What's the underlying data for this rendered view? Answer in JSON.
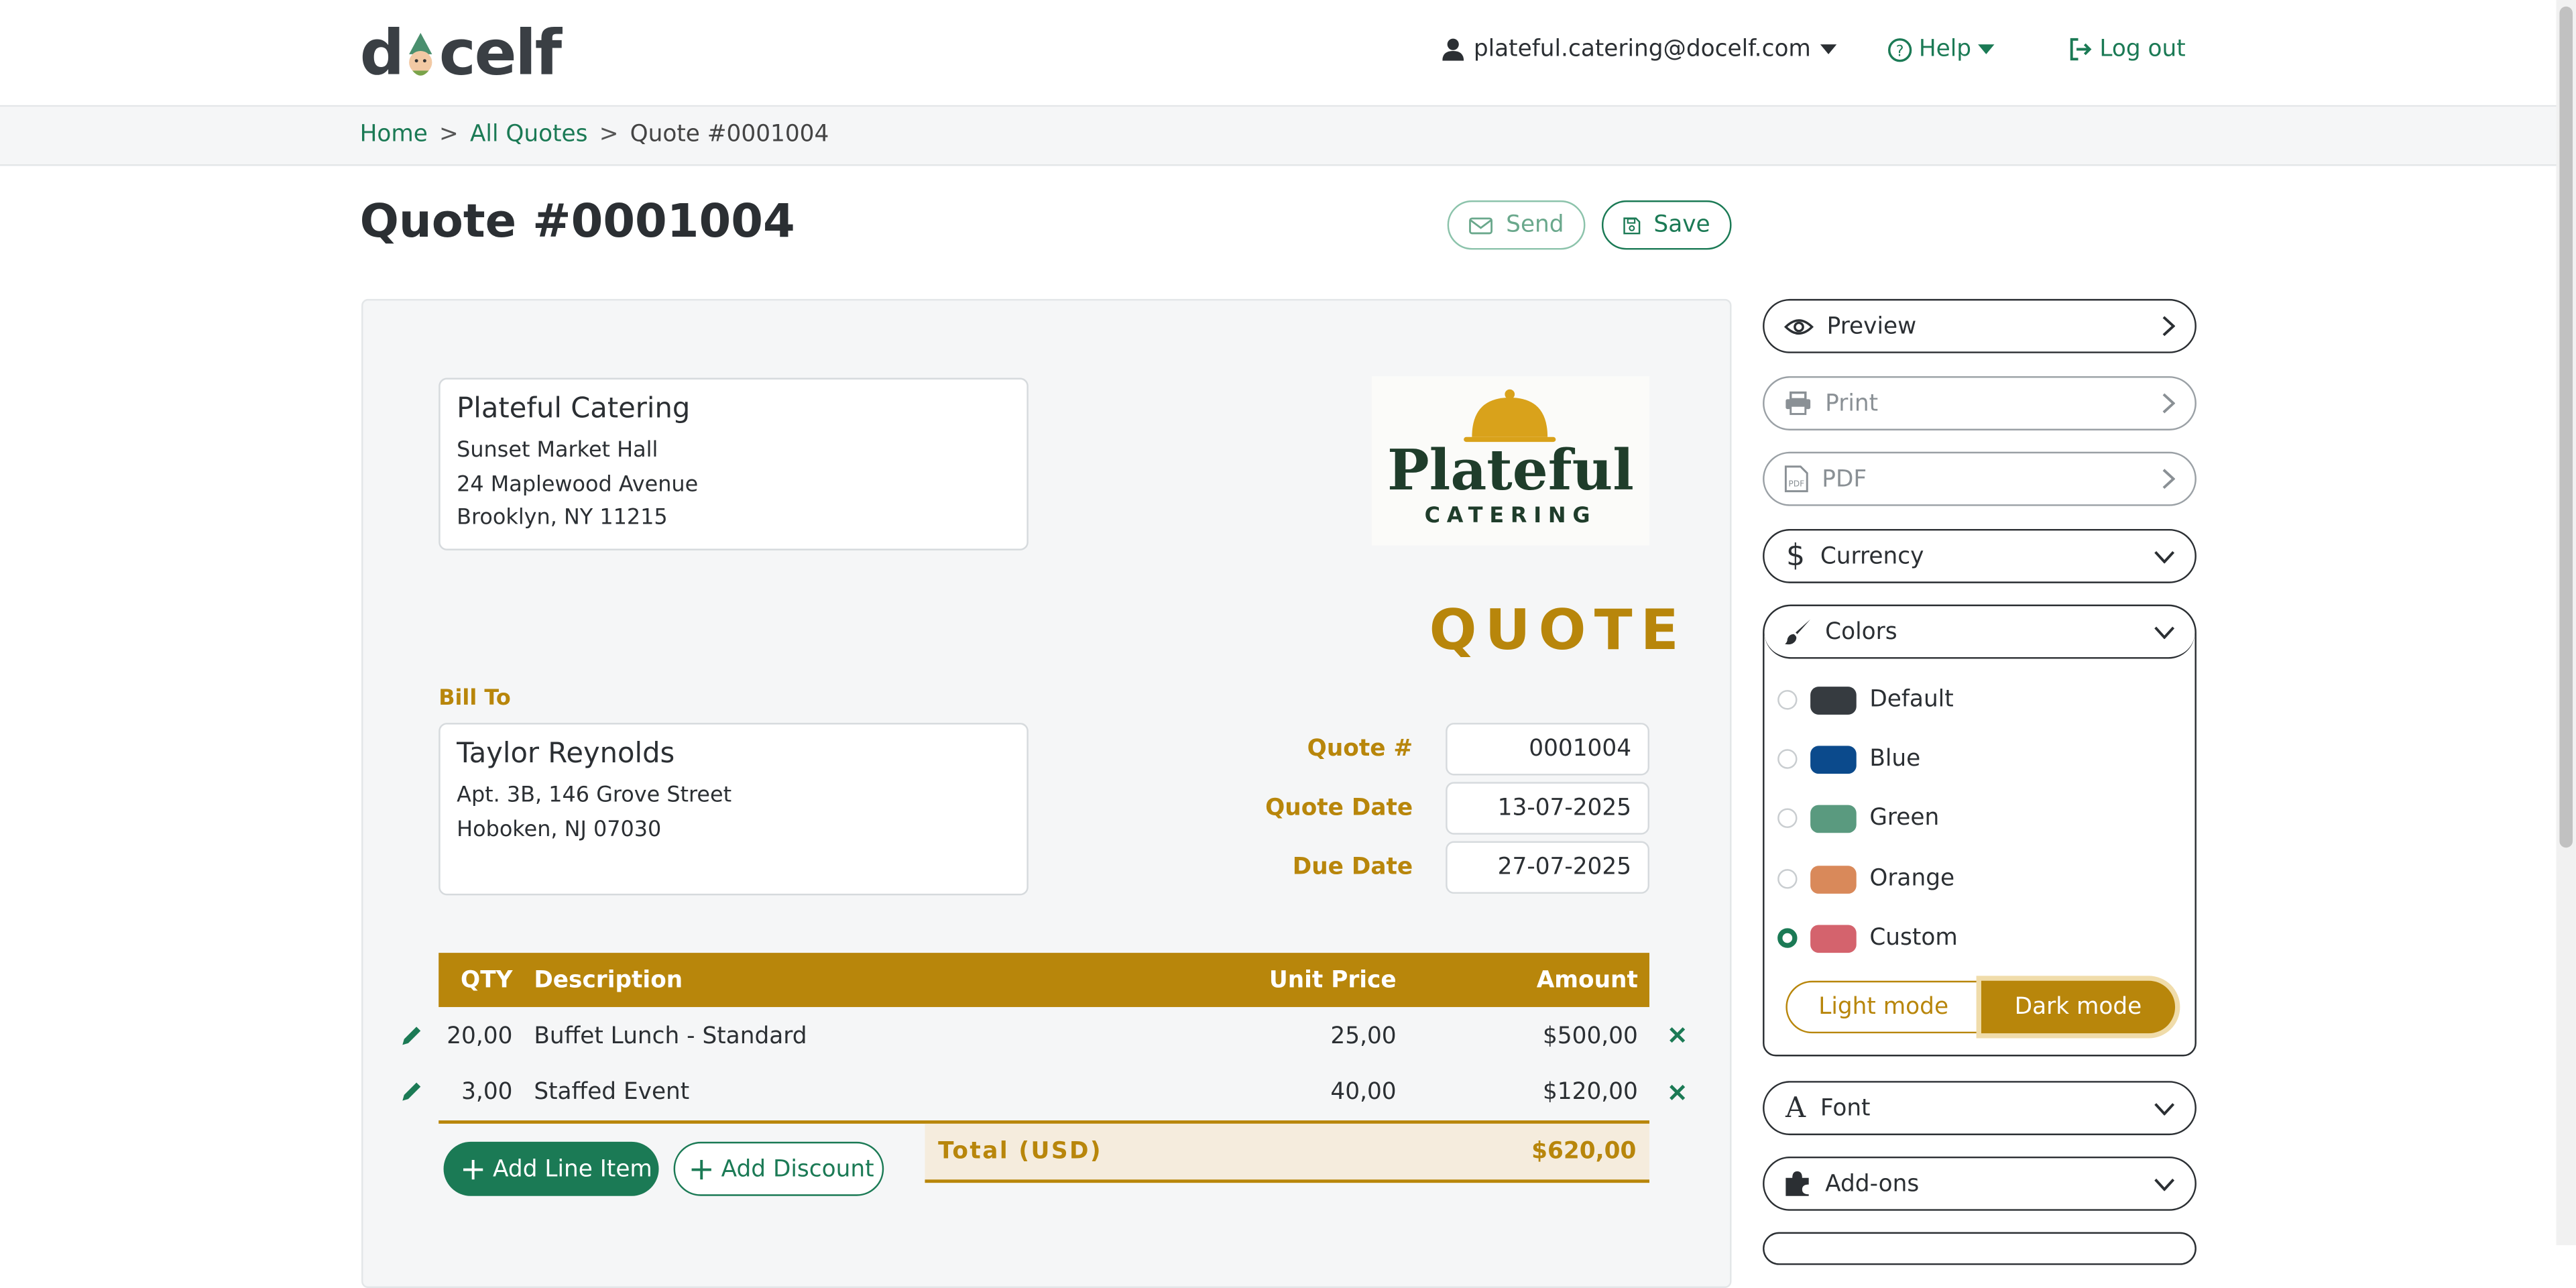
{
  "header": {
    "logo_text_pre": "d",
    "logo_text_post": "celf",
    "user_email": "plateful.catering@docelf.com",
    "help_label": "Help",
    "logout_label": "Log out"
  },
  "breadcrumb": [
    "Home",
    "All Quotes",
    "Quote #0001004"
  ],
  "page": {
    "title": "Quote #0001004",
    "send_label": "Send",
    "save_label": "Save"
  },
  "quote": {
    "from": {
      "name": "Plateful Catering",
      "lines": [
        "Sunset Market Hall",
        "24 Maplewood Avenue",
        "Brooklyn, NY 11215"
      ]
    },
    "company_logo": {
      "brand": "Plateful",
      "tagline": "CATERING"
    },
    "doc_type": "QUOTE",
    "bill_to_label": "Bill To",
    "bill_to": {
      "name": "Taylor Reynolds",
      "lines": [
        "Apt. 3B, 146 Grove Street",
        "Hoboken, NJ 07030"
      ]
    },
    "meta": [
      {
        "label": "Quote #",
        "value": "0001004"
      },
      {
        "label": "Quote Date",
        "value": "13-07-2025"
      },
      {
        "label": "Due Date",
        "value": "27-07-2025"
      }
    ],
    "table": {
      "headers": {
        "qty": "QTY",
        "description": "Description",
        "unit_price": "Unit Price",
        "amount": "Amount"
      },
      "rows": [
        {
          "qty": "20,00",
          "description": "Buffet Lunch - Standard",
          "unit_price": "25,00",
          "amount": "$500,00"
        },
        {
          "qty": "3,00",
          "description": "Staffed Event",
          "unit_price": "40,00",
          "amount": "$120,00"
        }
      ]
    },
    "total_label": "Total (USD)",
    "total_value": "$620,00",
    "add_line_label": "Add Line Item",
    "add_discount_label": "Add Discount"
  },
  "sidebar": {
    "preview_label": "Preview",
    "print_label": "Print",
    "pdf_label": "PDF",
    "currency_label": "Currency",
    "colors_label": "Colors",
    "color_options": [
      {
        "label": "Default",
        "color": "#363b40",
        "selected": false
      },
      {
        "label": "Blue",
        "color": "#0b4a8c",
        "selected": false
      },
      {
        "label": "Green",
        "color": "#5a9a7f",
        "selected": false
      },
      {
        "label": "Orange",
        "color": "#d9895a",
        "selected": false
      },
      {
        "label": "Custom",
        "color": "#d4636d",
        "selected": true
      }
    ],
    "light_mode_label": "Light mode",
    "dark_mode_label": "Dark mode",
    "font_label": "Font",
    "addons_label": "Add-ons"
  },
  "colors": {
    "accent": "#b8860b",
    "brand": "#1b7a55"
  }
}
